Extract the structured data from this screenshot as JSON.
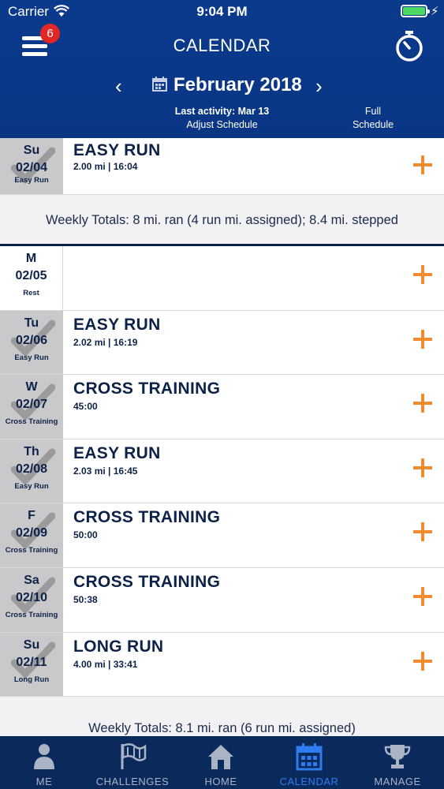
{
  "status_bar": {
    "carrier": "Carrier",
    "time": "9:04 PM"
  },
  "header": {
    "title": "CALENDAR",
    "menu_badge": "6",
    "month": "February 2018",
    "last_activity": "Last activity: Mar 13",
    "adjust_schedule": "Adjust Schedule",
    "full_schedule_line1": "Full",
    "full_schedule_line2": "Schedule"
  },
  "top_row": {
    "day": "Su",
    "date": "02/04",
    "type": "Easy Run",
    "title": "EASY RUN",
    "detail": "2.00 mi | 16:04",
    "completed": true
  },
  "weekly_totals_1": "Weekly Totals: 8 mi. ran (4 run mi. assigned); 8.4 mi. stepped",
  "days": [
    {
      "day": "M",
      "date": "02/05",
      "type": "Rest",
      "title": "",
      "detail": "",
      "completed": false
    },
    {
      "day": "Tu",
      "date": "02/06",
      "type": "Easy Run",
      "title": "EASY RUN",
      "detail": "2.02 mi | 16:19",
      "completed": true
    },
    {
      "day": "W",
      "date": "02/07",
      "type": "Cross Training",
      "title": "CROSS TRAINING",
      "detail": "45:00",
      "completed": true
    },
    {
      "day": "Th",
      "date": "02/08",
      "type": "Easy Run",
      "title": "EASY RUN",
      "detail": "2.03 mi | 16:45",
      "completed": true
    },
    {
      "day": "F",
      "date": "02/09",
      "type": "Cross Training",
      "title": "CROSS TRAINING",
      "detail": "50:00",
      "completed": true
    },
    {
      "day": "Sa",
      "date": "02/10",
      "type": "Cross Training",
      "title": "CROSS TRAINING",
      "detail": "50:38",
      "completed": true
    },
    {
      "day": "Su",
      "date": "02/11",
      "type": "Long Run",
      "title": "LONG RUN",
      "detail": "4.00 mi | 33:41",
      "completed": true
    }
  ],
  "weekly_totals_2": "Weekly Totals: 8.1 mi. ran (6 run mi. assigned)",
  "tabs": [
    {
      "label": "ME",
      "icon": "person-icon"
    },
    {
      "label": "CHALLENGES",
      "icon": "flag-icon"
    },
    {
      "label": "HOME",
      "icon": "home-icon"
    },
    {
      "label": "CALENDAR",
      "icon": "calendar-icon"
    },
    {
      "label": "MANAGE",
      "icon": "trophy-icon"
    }
  ],
  "colors": {
    "header": "#0b3a8d",
    "accent": "#ef8c2c",
    "active_tab": "#2f7bf0",
    "tabbar": "#0a2a5c",
    "badge": "#e22626"
  }
}
